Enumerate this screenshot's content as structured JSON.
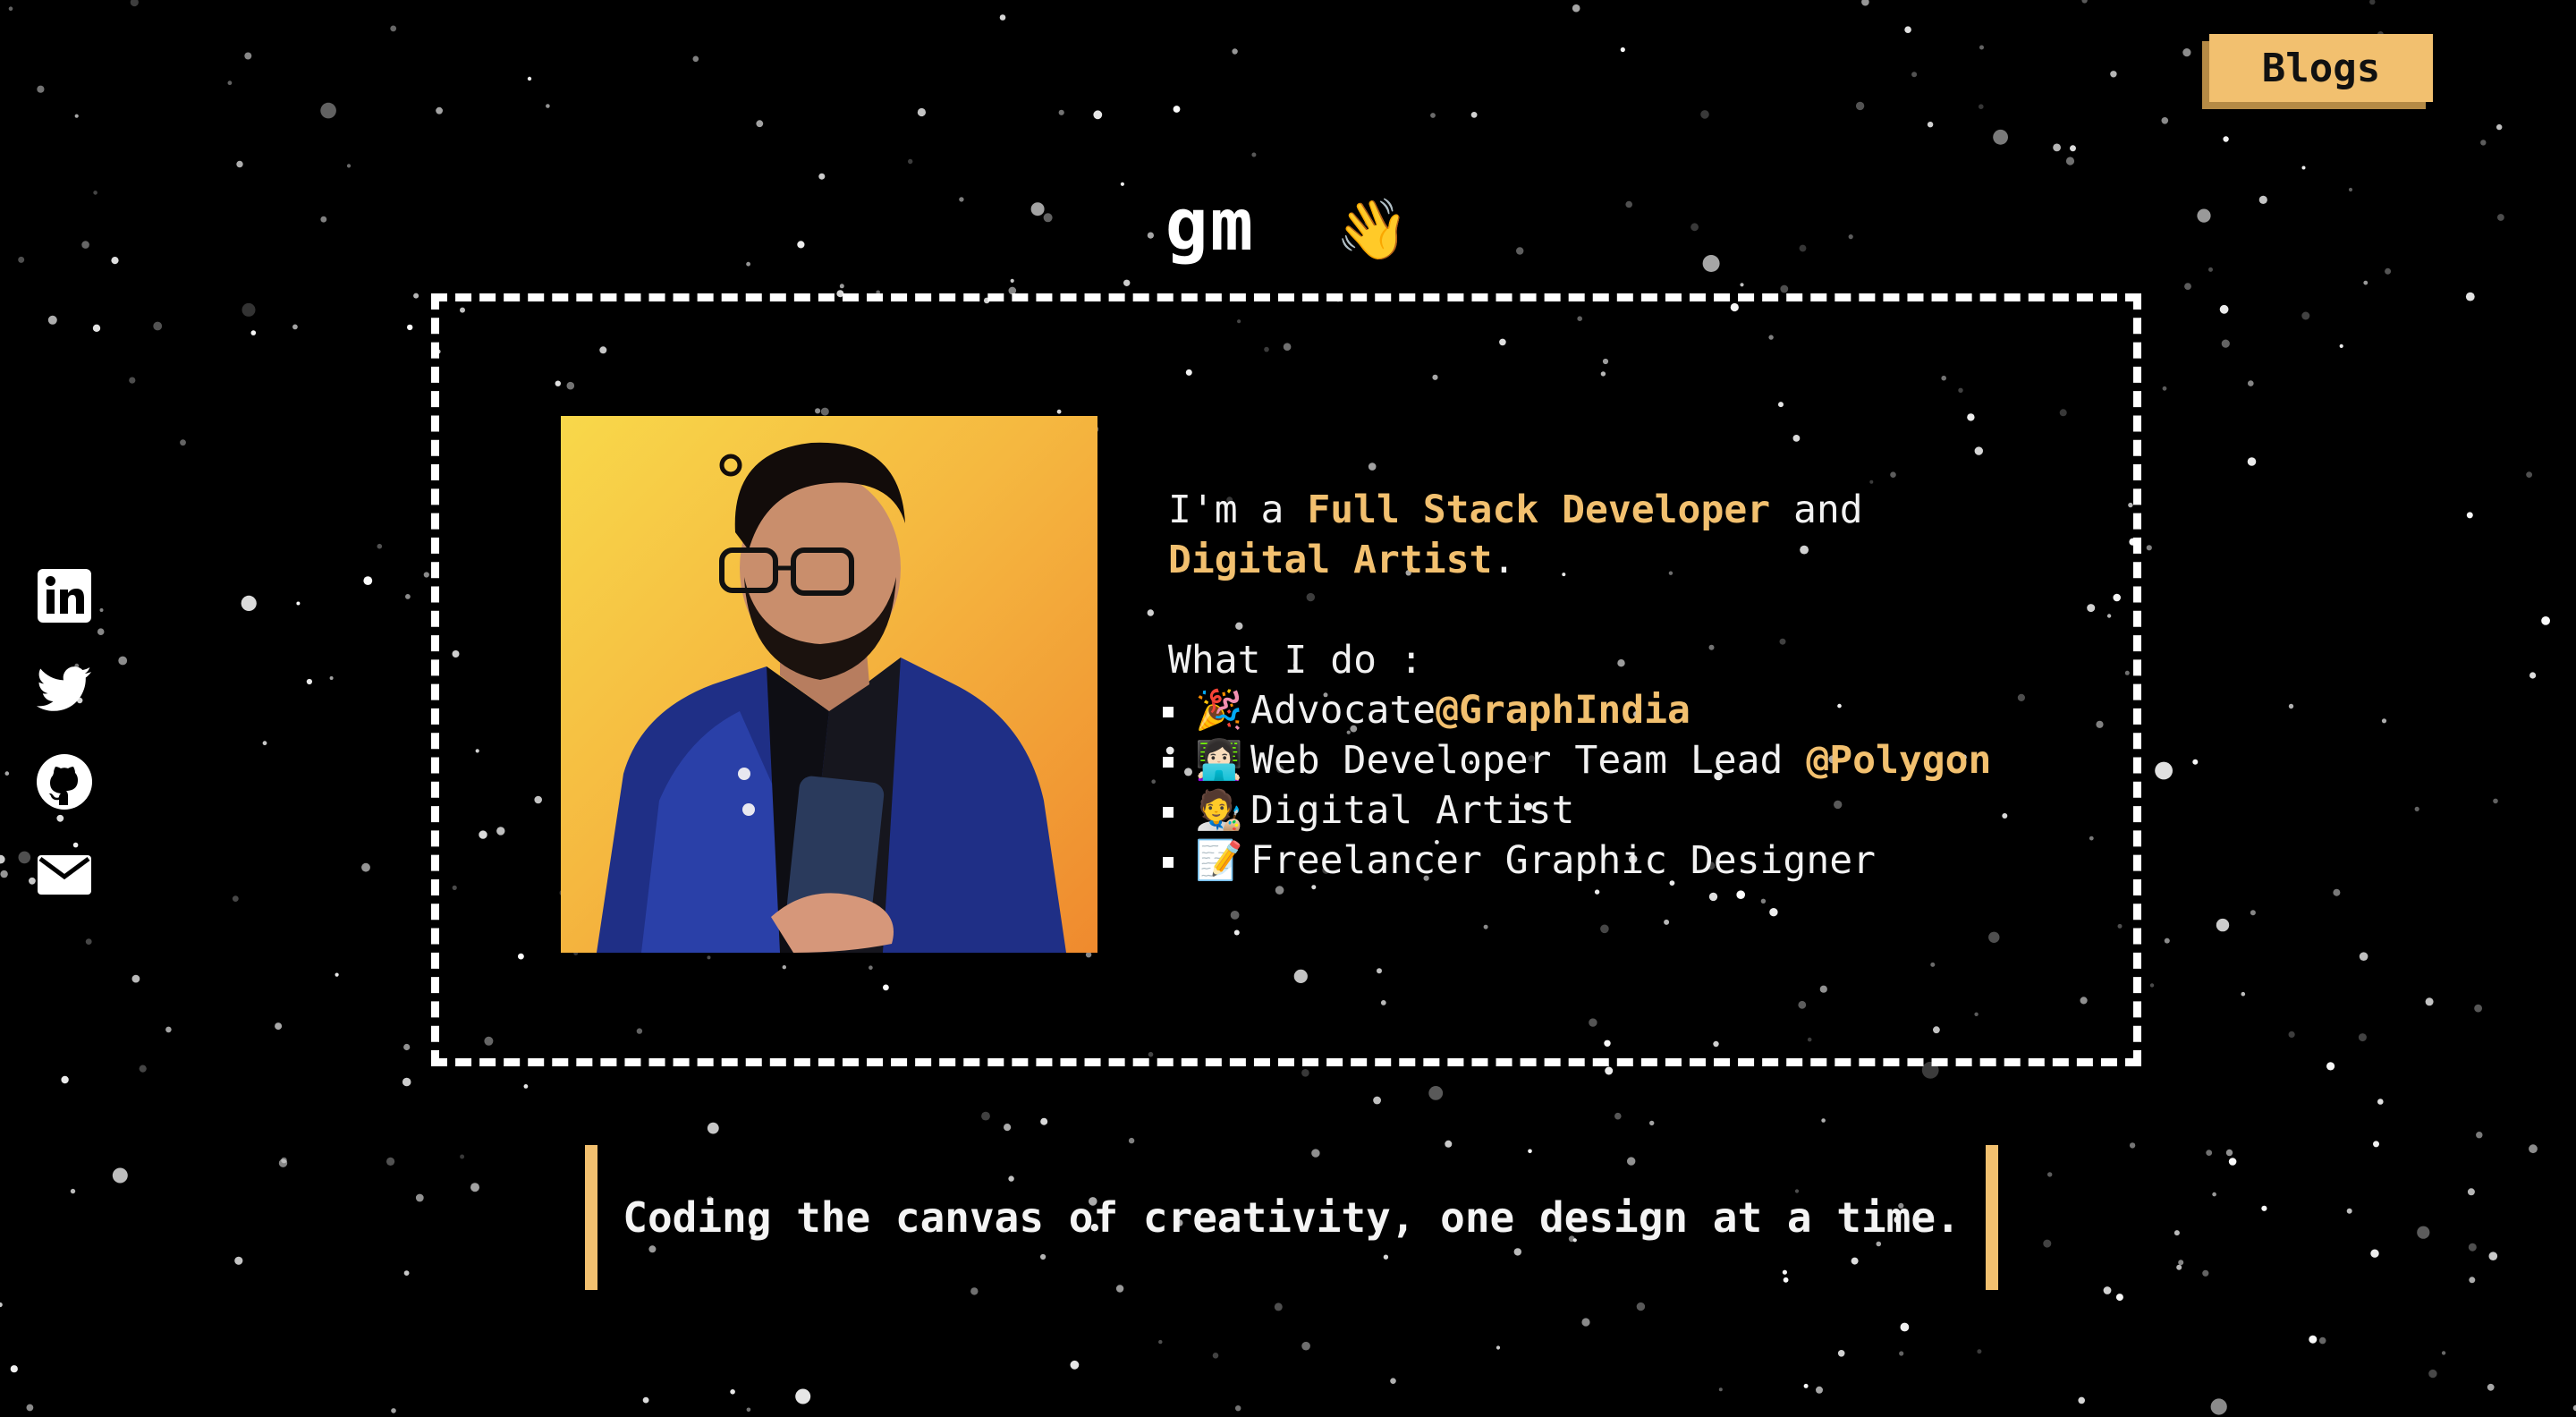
{
  "header": {
    "blogs_label": "Blogs"
  },
  "greeting": {
    "text": "gm",
    "emoji": "👋"
  },
  "about": {
    "intro_prefix": "I'm a ",
    "role_1": "Full Stack Developer",
    "intro_joiner": " and",
    "role_2": "Digital Artist",
    "intro_suffix": ".",
    "what_i_do_label": "What I do :",
    "items": [
      {
        "emoji": "🎉",
        "text": "Advocate",
        "highlight": "@GraphIndia"
      },
      {
        "emoji": "👩🏻‍💻",
        "text": "Web Developer Team Lead ",
        "highlight": "@Polygon"
      },
      {
        "emoji": "🧑‍🎨",
        "text": "Digital Artist",
        "highlight": ""
      },
      {
        "emoji": "📝",
        "text": "Freelancer Graphic Designer",
        "highlight": ""
      }
    ]
  },
  "social": [
    {
      "icon": "linkedin-icon"
    },
    {
      "icon": "twitter-icon"
    },
    {
      "icon": "github-icon"
    },
    {
      "icon": "email-icon"
    }
  ],
  "tagline": "Coding the canvas of creativity, one design at a time.",
  "colors": {
    "accent": "#f2c06f",
    "background": "#000000",
    "text": "#ffffff"
  }
}
